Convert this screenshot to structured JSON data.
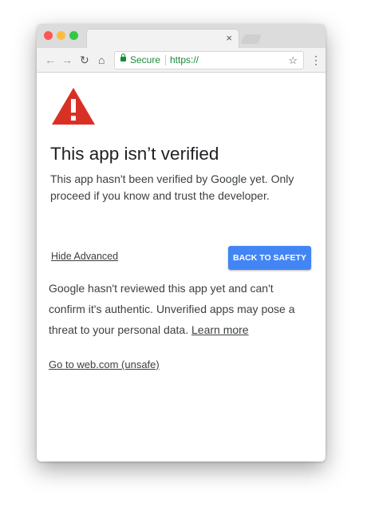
{
  "browser": {
    "tab_close": "×",
    "secure_label": "Secure",
    "url": "https://"
  },
  "page": {
    "title": "This app isn’t verified",
    "description": "This app hasn't been verified by Google yet. Only proceed if you know and trust the developer.",
    "hide_advanced": "Hide Advanced",
    "back_to_safety": "BACK TO SAFETY",
    "advanced_text": "Google hasn't reviewed this app yet and can't confirm it's authentic. Unverified apps may pose a threat to your personal data.",
    "learn_more": "Learn more",
    "proceed_link": "Go to web.com (unsafe)"
  },
  "icons": {
    "warning": "warning-triangle-icon",
    "lock": "lock-icon",
    "star": "star-icon",
    "menu": "menu-icon"
  },
  "colors": {
    "warning_red": "#d93025",
    "button_blue": "#4285f4",
    "secure_green": "#1a8a3a"
  }
}
